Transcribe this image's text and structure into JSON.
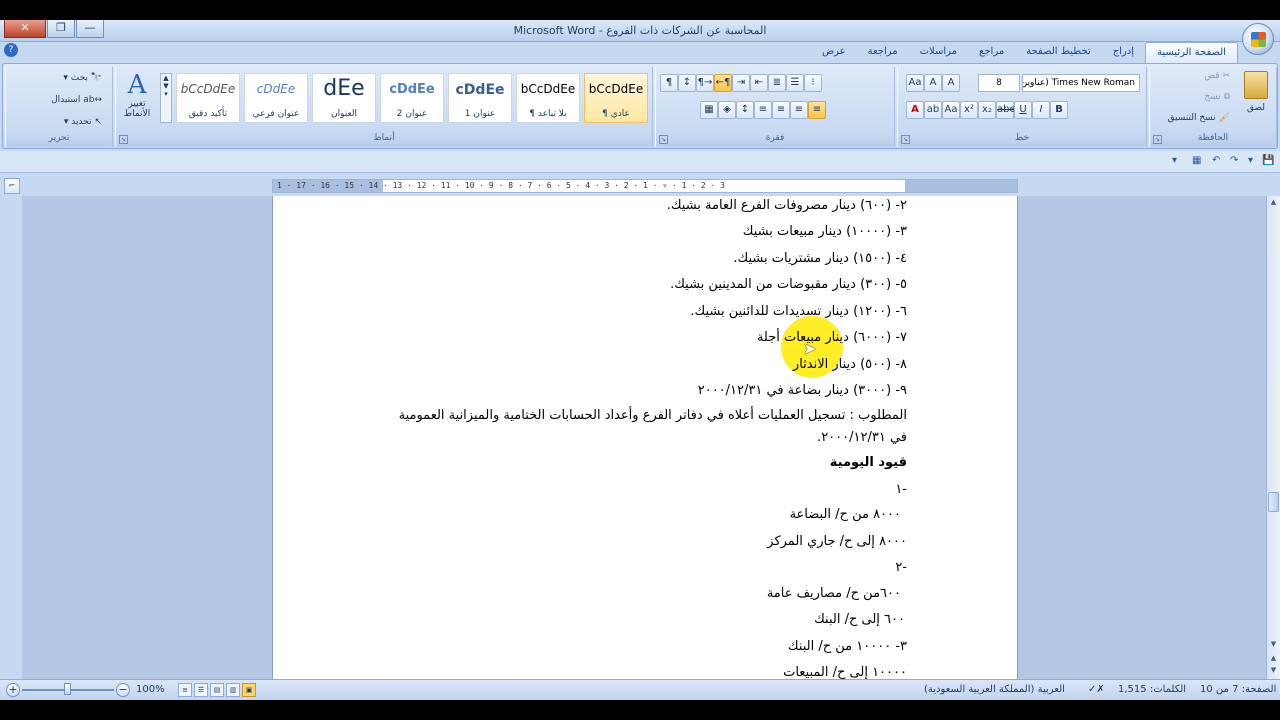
{
  "window": {
    "title": "المحاسبة عن الشركات ذات الفروع - Microsoft Word",
    "buttons": {
      "close": "✕",
      "restore": "❐",
      "minimize": "—"
    }
  },
  "tabs": [
    {
      "label": "الصفحة الرئيسية",
      "active": true
    },
    {
      "label": "إدراج"
    },
    {
      "label": "تخطيط الصفحة"
    },
    {
      "label": "مراجع"
    },
    {
      "label": "مراسلات"
    },
    {
      "label": "مراجعة"
    },
    {
      "label": "عرض"
    }
  ],
  "ribbon": {
    "clipboard": {
      "label": "الحافظة",
      "paste": "لصق",
      "cut": "قص",
      "copy": "نسخ",
      "format_painter": "نسخ التنسيق"
    },
    "font": {
      "label": "خط",
      "font_name": "Times New Roman (عناوين",
      "font_size": "8",
      "bold": "B",
      "italic": "I",
      "underline": "U",
      "strike": "abe",
      "subscript": "x₂",
      "superscript": "x²",
      "change_case": "Aa",
      "grow": "A",
      "shrink": "A",
      "clear": "Aa"
    },
    "paragraph": {
      "label": "فقرة"
    },
    "styles": {
      "label": "أنماط",
      "items": [
        {
          "sample": "bCcDdEe",
          "name": "¶ عادي",
          "selected": true
        },
        {
          "sample": "bCcDdEe",
          "name": "¶ بلا تباعد"
        },
        {
          "sample": "cDdEe",
          "name": "عنوان 1"
        },
        {
          "sample": "cDdEe",
          "name": "عنوان 2"
        },
        {
          "sample": "dEe",
          "name": "العنوان"
        },
        {
          "sample": "cDdEe",
          "name": "عنوان فرعي"
        },
        {
          "sample": "bCcDdEe",
          "name": "تأكيد دقيق"
        }
      ],
      "change_styles_line1": "تغيير",
      "change_styles_line2": "الأنماط"
    },
    "editing": {
      "label": "تحرير",
      "find": "بحث",
      "replace": "استبدال",
      "select": "تحديد"
    }
  },
  "ruler": {
    "numbers": "1 · 17 · 16 · 15 · 14 · 13 · 12 · 11 · 10 · 9 · 8 · 7 · 6 · 5 · 4 · 3 · 2 · 1 · ▿ · 1 · 2 · 3"
  },
  "document": {
    "lines": [
      "٢- (٦٠٠) دينار مصروفات الفرع العامة بشيك.",
      "٣- (١٠٠٠٠) دينار مبيعات بشيك",
      "٤- (١٥٠٠) دينار مشتريات بشيك.",
      "٥- (٣٠٠) دينار مقبوضات من المدينين بشيك.",
      "٦- (١٢٠٠) دينار تسديدات للدائنين بشيك.",
      "٧- (٦٠٠٠) دينار مبيعات أجلة",
      "٨- (٥٠٠) دينار الاندثار",
      "٩- (٣٠٠٠) دينار بضاعة في ٢٠٠٠/١٢/٣١",
      "المطلوب : تسجيل العمليات أعلاه في دفاتر الفرع وأعداد الحسابات الختامية والميزانية العمومية",
      "في ٢٠٠٠/١٢/٣١.",
      "قيود اليومية",
      "١-",
      "٨٠٠٠ من ح/ البضاعة",
      "٨٠٠٠ إلى ح/ جاري المركز",
      "٢-",
      "٦٠٠من ح/ مصاريف عامة",
      "٦٠٠ إلى ح/ البنك",
      "٣- ١٠٠٠٠ من ح/ البنك",
      "١٠٠٠٠ إلى ح/ المبيعات"
    ]
  },
  "status": {
    "page": "الصفحة: 7 من 10",
    "words": "الكلمات: 1,515",
    "language": "العربية (المملكة العربية السعودية)",
    "zoom": "100%",
    "zoom_level": 1.0
  }
}
